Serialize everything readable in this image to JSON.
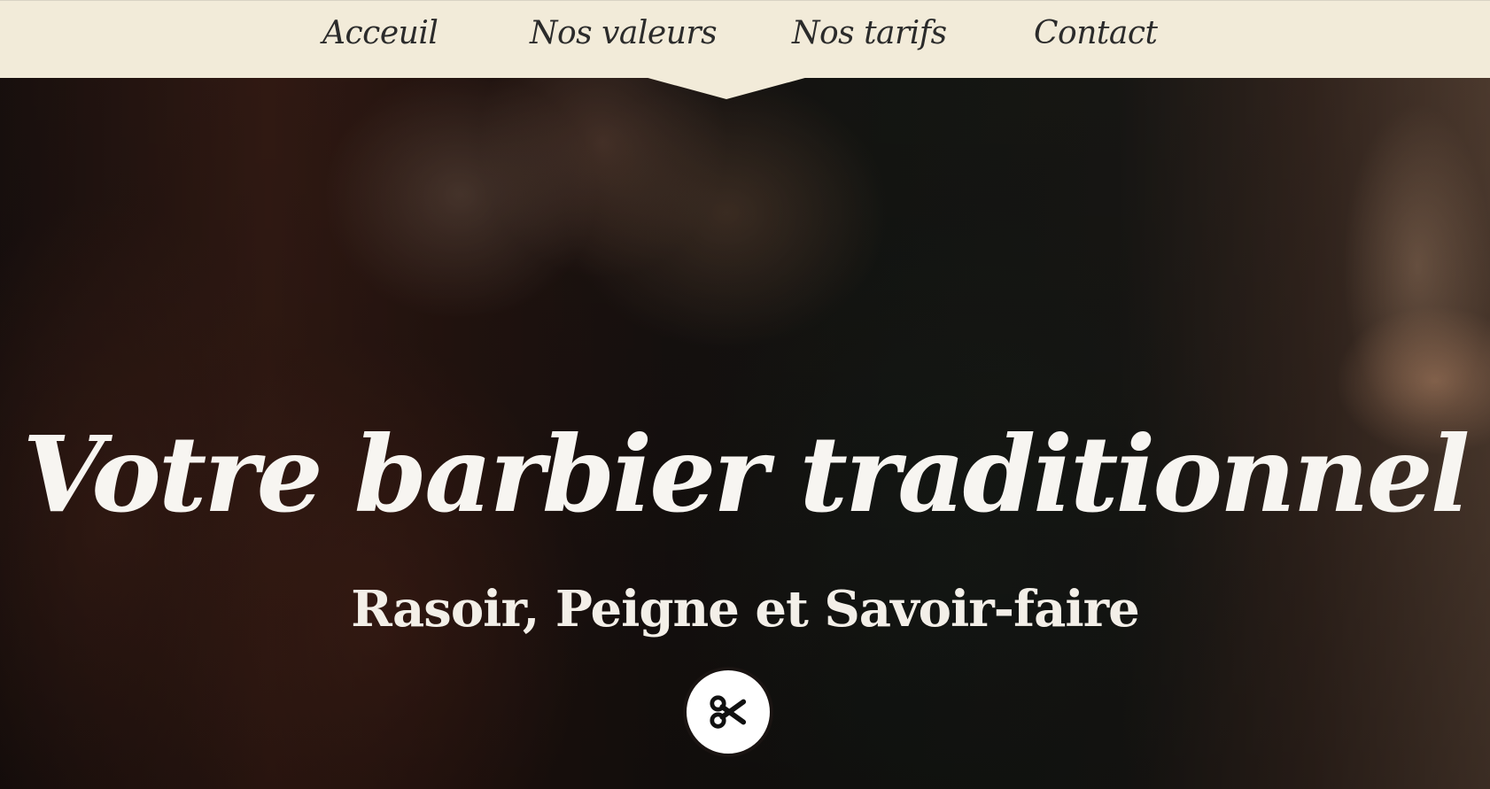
{
  "nav": {
    "items": [
      {
        "label": "Acceuil"
      },
      {
        "label": "Nos valeurs"
      },
      {
        "label": "Nos tarifs"
      },
      {
        "label": "Contact"
      }
    ]
  },
  "hero": {
    "title": "Votre barbier traditionnel",
    "subtitle": "Rasoir, Peigne et Savoir-faire",
    "button_icon": "scissors-icon"
  },
  "colors": {
    "header_background": "#f2ebd9",
    "nav_text": "#2b2b2b",
    "hero_text": "#f7f5f1",
    "button_background": "#ffffff",
    "icon_color": "#111111"
  }
}
